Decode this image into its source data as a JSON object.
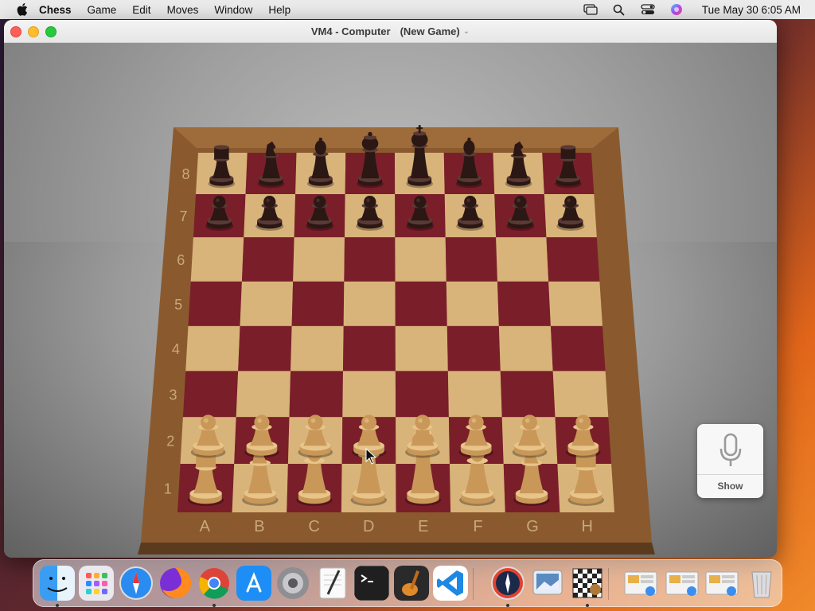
{
  "menubar": {
    "app_name": "Chess",
    "menus": [
      "Game",
      "Edit",
      "Moves",
      "Window",
      "Help"
    ],
    "clock": "Tue May 30  6:05 AM"
  },
  "window": {
    "title": "VM4 - Computer",
    "subtitle": "(New Game)"
  },
  "board": {
    "files": [
      "A",
      "B",
      "C",
      "D",
      "E",
      "F",
      "G",
      "H"
    ],
    "ranks": [
      "8",
      "7",
      "6",
      "5",
      "4",
      "3",
      "2",
      "1"
    ],
    "light_square": "#d9b47a",
    "dark_square": "#7a1f2a",
    "frame_color": "#8a5a2e",
    "pieces": {
      "8": [
        "r",
        "n",
        "b",
        "q",
        "k",
        "b",
        "n",
        "r"
      ],
      "7": [
        "p",
        "p",
        "p",
        "p",
        "p",
        "p",
        "p",
        "p"
      ],
      "2": [
        "P",
        "P",
        "P",
        "P",
        "P",
        "P",
        "P",
        "P"
      ],
      "1": [
        "R",
        "N",
        "B",
        "Q",
        "K",
        "B",
        "N",
        "R"
      ]
    },
    "black_piece_color": "#2b1714",
    "white_piece_color": "#c99858"
  },
  "dictation": {
    "label": "Show",
    "icon": "microphone-icon"
  },
  "dock": {
    "apps": [
      {
        "name": "Finder",
        "icon": "finder-icon",
        "running": true
      },
      {
        "name": "Launchpad",
        "icon": "launchpad-icon",
        "running": false
      },
      {
        "name": "Safari",
        "icon": "safari-icon",
        "running": false
      },
      {
        "name": "Firefox",
        "icon": "firefox-icon",
        "running": false
      },
      {
        "name": "Chrome",
        "icon": "chrome-icon",
        "running": true
      },
      {
        "name": "App Store",
        "icon": "app-store-icon",
        "running": false
      },
      {
        "name": "System Settings",
        "icon": "system-settings-icon",
        "running": false
      },
      {
        "name": "TextEdit",
        "icon": "textedit-icon",
        "running": false
      },
      {
        "name": "Terminal",
        "icon": "terminal-icon",
        "running": false
      },
      {
        "name": "GarageBand",
        "icon": "garageband-icon",
        "running": false
      },
      {
        "name": "Visual Studio Code",
        "icon": "vscode-icon",
        "running": false
      },
      {
        "name": "Safari Technology Preview",
        "icon": "compass-icon",
        "running": true
      },
      {
        "name": "Preview",
        "icon": "preview-icon",
        "running": false
      },
      {
        "name": "Chess",
        "icon": "chess-icon",
        "running": true
      },
      {
        "name": "Recent 1",
        "icon": "document-stack-icon",
        "running": false
      },
      {
        "name": "Recent 2",
        "icon": "document-stack-icon",
        "running": false
      },
      {
        "name": "Recent 3",
        "icon": "document-stack-icon",
        "running": false
      },
      {
        "name": "Trash",
        "icon": "trash-icon",
        "running": false
      }
    ]
  }
}
